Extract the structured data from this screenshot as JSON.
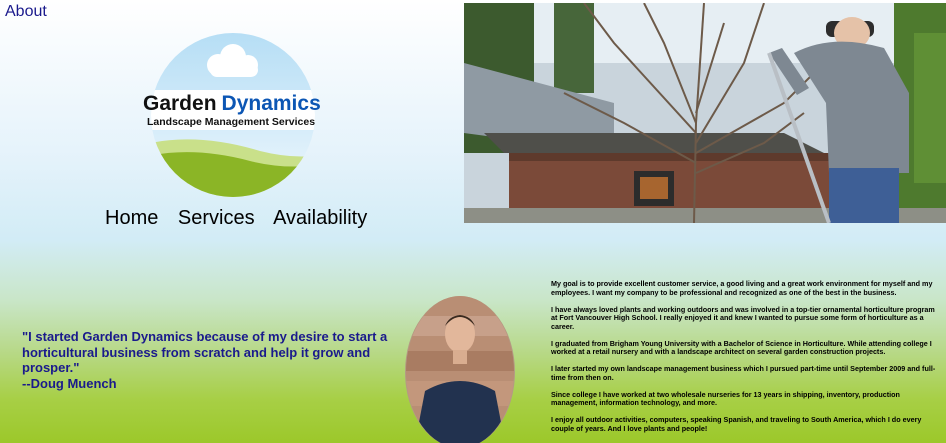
{
  "nav": {
    "about": "About",
    "links": [
      "Home",
      "Services",
      "Availability"
    ]
  },
  "logo": {
    "name_part1": "Garden",
    "name_part2": "Dynamics",
    "tagline": "Landscape Management Services",
    "colors": {
      "accent": "#0c56b4",
      "green": "#8bb526"
    }
  },
  "quote": {
    "text": "\"I started Garden Dynamics because of my desire to start a horticultural business from scratch and help it grow and prosper.\"",
    "author": "--Doug Muench"
  },
  "bio": {
    "paragraphs": [
      "My goal is to provide excellent customer service, a good living and a great work environment for myself and my employees. I want my company to be professional and recognized as one of the best in the business.",
      "I have always loved plants and working outdoors and was involved in a top-tier ornamental horticulture program at Fort Vancouver High School. I really enjoyed it and knew I wanted to pursue some form of horticulture as a career.",
      "I graduated from Brigham Young University with a Bachelor of Science in Horticulture. While attending college I worked at a retail nursery and with a landscape architect on several garden construction projects.",
      "I later started my own landscape management business which I pursued part-time until September 2009 and full-time from then on.",
      "Since college I have worked at two wholesale nurseries for 13 years in shipping, inventory, production management, information technology, and more.",
      "I enjoy all outdoor activities, computers, speaking Spanish, and traveling to South America, which I do every couple of years. And I love plants and people!"
    ]
  }
}
